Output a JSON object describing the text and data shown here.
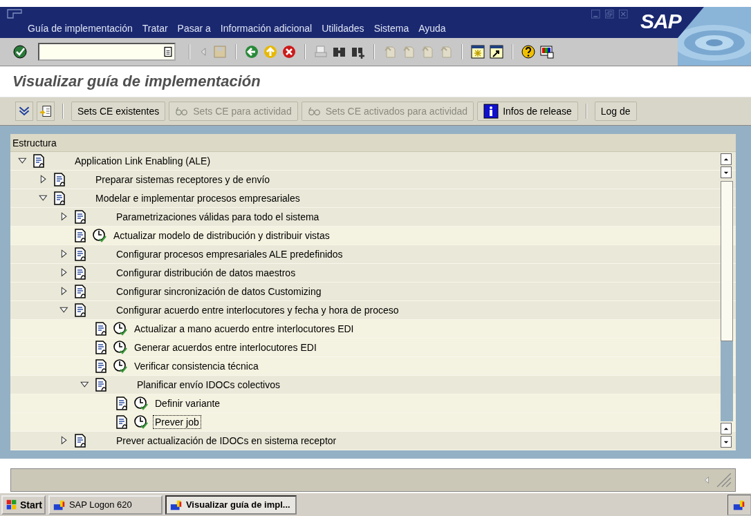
{
  "menu_bar": {
    "menus": [
      "Guía de implementación",
      "Tratar",
      "Pasar a",
      "Información adicional",
      "Utilidades",
      "Sistema",
      "Ayuda"
    ],
    "logo": "SAP"
  },
  "screen_title": "Visualizar guía de implementación",
  "app_toolbar": {
    "buttons": [
      {
        "label": "Sets CE existentes",
        "disabled": false,
        "kind": "text"
      },
      {
        "label": "Sets CE para actividad",
        "disabled": true,
        "kind": "glasses"
      },
      {
        "label": "Sets CE activados para actividad",
        "disabled": true,
        "kind": "glasses"
      },
      {
        "label": "Infos de release",
        "disabled": false,
        "kind": "info"
      },
      {
        "label": "Log de",
        "disabled": false,
        "kind": "text"
      }
    ]
  },
  "tree": {
    "header": "Estructura",
    "nodes": [
      {
        "label": "Application Link Enabling (ALE)",
        "kind": "folder",
        "expanded": true,
        "selected": false,
        "children": [
          {
            "label": "Preparar sistemas receptores y de envío",
            "kind": "folder",
            "expanded": false,
            "selected": false
          },
          {
            "label": "Modelar e implementar procesos empresariales",
            "kind": "folder",
            "expanded": true,
            "selected": false,
            "children": [
              {
                "label": "Parametrizaciones válidas para todo el sistema",
                "kind": "folder",
                "expanded": false,
                "selected": false
              },
              {
                "label": "Actualizar modelo de distribución y distribuir vistas",
                "kind": "activity",
                "selected": false
              },
              {
                "label": "Configurar procesos empresariales ALE predefinidos",
                "kind": "folder",
                "expanded": false,
                "selected": false
              },
              {
                "label": "Configurar distribución de datos maestros",
                "kind": "folder",
                "expanded": false,
                "selected": false
              },
              {
                "label": "Configurar sincronización de datos Customizing",
                "kind": "folder",
                "expanded": false,
                "selected": false
              },
              {
                "label": "Configurar acuerdo entre interlocutores y fecha y hora de proceso",
                "kind": "folder",
                "expanded": true,
                "selected": false,
                "children": [
                  {
                    "label": "Actualizar a mano acuerdo entre interlocutores EDI",
                    "kind": "activity",
                    "selected": false
                  },
                  {
                    "label": "Generar acuerdos entre interlocutores EDI",
                    "kind": "activity",
                    "selected": false
                  },
                  {
                    "label": "Verificar consistencia técnica",
                    "kind": "activity",
                    "selected": false
                  },
                  {
                    "label": "Planificar envío IDOCs colectivos",
                    "kind": "folder",
                    "expanded": true,
                    "selected": false,
                    "children": [
                      {
                        "label": "Definir variante",
                        "kind": "activity",
                        "selected": false
                      },
                      {
                        "label": "Prever job",
                        "kind": "activity",
                        "selected": true
                      }
                    ]
                  }
                ]
              },
              {
                "label": "Prever actualización de IDOCs en sistema receptor",
                "kind": "folder",
                "expanded": false,
                "selected": false
              }
            ]
          }
        ]
      }
    ]
  },
  "taskbar": {
    "start": "Start",
    "tasks": [
      {
        "label": "SAP Logon 620",
        "selected": false
      },
      {
        "label": "Visualizar guía de impl...",
        "selected": true
      }
    ]
  }
}
